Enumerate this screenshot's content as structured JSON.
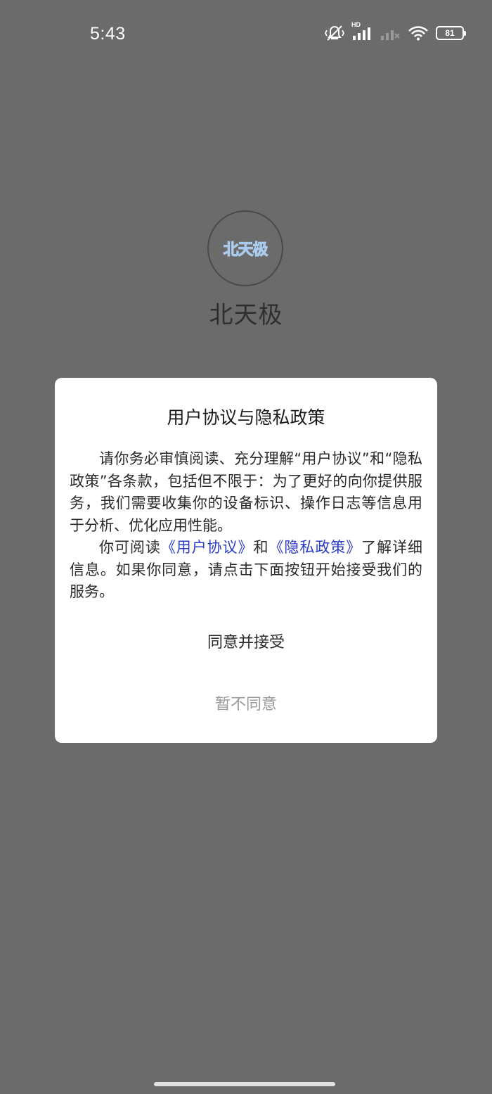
{
  "status_bar": {
    "time": "5:43",
    "network_label": "HD",
    "battery_level": "81",
    "icons": [
      "mute-vibrate-icon",
      "signal-hd-icon",
      "signal-no-service-icon",
      "wifi-icon",
      "battery-icon"
    ]
  },
  "app": {
    "logo_text": "北天极",
    "name": "北天极"
  },
  "dialog": {
    "title": "用户协议与隐私政策",
    "paragraph1": "请你务必审慎阅读、充分理解“用户协议”和“隐私政策”各条款，包括但不限于：为了更好的向你提供服务，我们需要收集你的设备标识、操作日志等信息用于分析、优化应用性能。",
    "paragraph2_prefix": "你可阅读",
    "user_agreement_link": "《用户协议》",
    "paragraph2_and": "和",
    "privacy_policy_link": "《隐私政策》",
    "paragraph2_suffix": "了解详细信息。如果你同意，请点击下面按钮开始接受我们的服务。",
    "agree_label": "同意并接受",
    "disagree_label": "暂不同意"
  },
  "colors": {
    "overlay_background": "#6b6b6b",
    "link": "#2b3cc7",
    "disagree_text": "#9b9b9b"
  }
}
